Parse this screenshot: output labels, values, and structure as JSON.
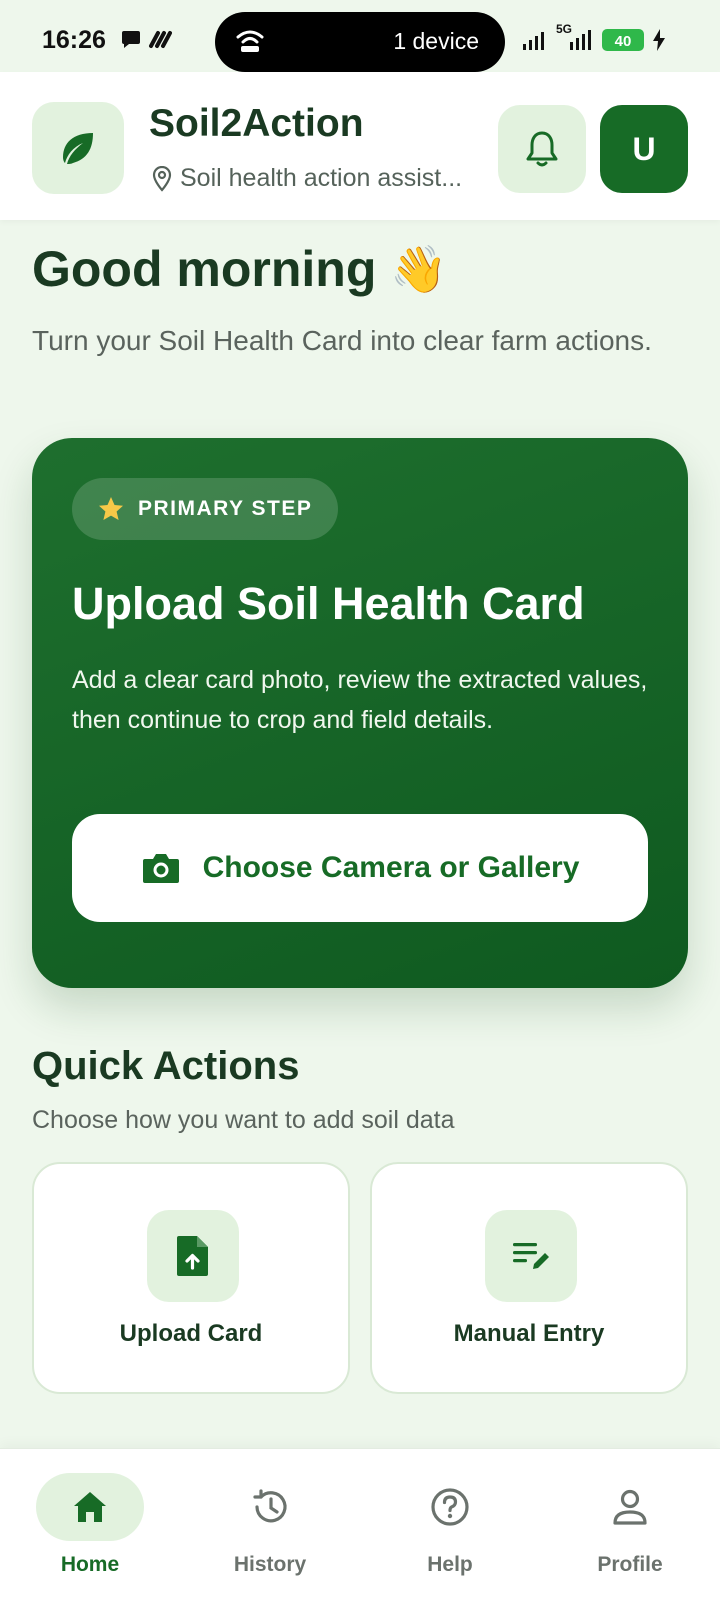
{
  "status_bar": {
    "time": "16:26",
    "pill_text": "1 device",
    "network": "5G",
    "battery": "40"
  },
  "header": {
    "app_title": "Soil2Action",
    "subtitle": "Soil health action assist...",
    "avatar_initial": "U",
    "icons": [
      "leaf-icon",
      "location-pin-icon",
      "bell-icon"
    ]
  },
  "greeting": {
    "title": "Good morning",
    "emoji": "👋",
    "intro": "Turn your Soil Health Card into clear farm actions."
  },
  "hero": {
    "badge": "PRIMARY STEP",
    "title": "Upload Soil Health Card",
    "description": "Add a clear card photo, review the extracted values, then continue to crop and field details.",
    "button_label": "Choose Camera or Gallery"
  },
  "quick_actions": {
    "title": "Quick Actions",
    "subtitle": "Choose how you want to add soil data",
    "items": [
      {
        "label": "Upload Card",
        "icon": "upload-file-icon"
      },
      {
        "label": "Manual Entry",
        "icon": "edit-list-icon"
      }
    ]
  },
  "bottom_nav": {
    "items": [
      {
        "label": "Home",
        "icon": "home-icon",
        "active": true
      },
      {
        "label": "History",
        "icon": "history-icon",
        "active": false
      },
      {
        "label": "Help",
        "icon": "help-icon",
        "active": false
      },
      {
        "label": "Profile",
        "icon": "profile-icon",
        "active": false
      }
    ]
  },
  "colors": {
    "primary": "#176b26",
    "background": "#eef7ec",
    "tint": "#e2f2de",
    "text": "#1a3a22"
  }
}
